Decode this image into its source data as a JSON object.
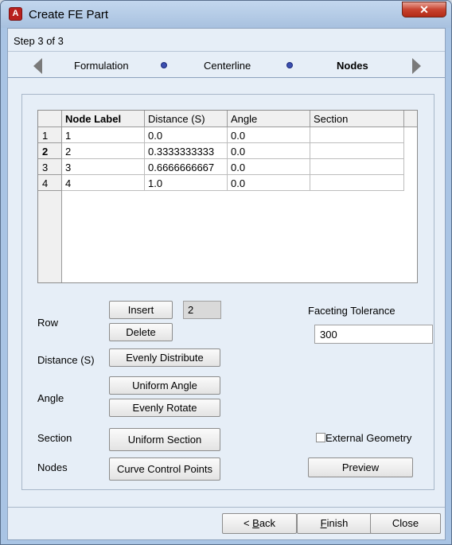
{
  "window": {
    "app_icon_letter": "A",
    "title": "Create FE Part",
    "close_glyph": "✕"
  },
  "step": {
    "label": "Step 3 of 3",
    "steps": [
      "Formulation",
      "Centerline",
      "Nodes"
    ],
    "current": "Nodes"
  },
  "table": {
    "columns": [
      "Node Label",
      "Distance (S)",
      "Angle",
      "Section"
    ],
    "row_headers": [
      "1",
      "2",
      "3",
      "4"
    ],
    "rows": [
      [
        "1",
        "0.0",
        "0.0",
        ""
      ],
      [
        "2",
        "0.3333333333",
        "0.0",
        ""
      ],
      [
        "3",
        "0.6666666667",
        "0.0",
        ""
      ],
      [
        "4",
        "1.0",
        "0.0",
        ""
      ]
    ]
  },
  "controls": {
    "row_label": "Row",
    "insert_label": "Insert",
    "insert_count": "2",
    "delete_label": "Delete",
    "distance_label": "Distance (S)",
    "evenly_distribute_label": "Evenly Distribute",
    "angle_label": "Angle",
    "uniform_angle_label": "Uniform Angle",
    "evenly_rotate_label": "Evenly Rotate",
    "section_label": "Section",
    "uniform_section_label": "Uniform Section",
    "nodes_label": "Nodes",
    "curve_control_points_label": "Curve Control Points",
    "faceting_tolerance_label": "Faceting Tolerance",
    "faceting_tolerance_value": "300",
    "external_geometry_label": "External Geometry",
    "external_geometry_checked": false,
    "preview_label": "Preview"
  },
  "footer": {
    "back_prefix": "< ",
    "back_mnemonic": "B",
    "back_rest": "ack",
    "finish_mnemonic": "F",
    "finish_rest": "inish",
    "close_label": "Close"
  }
}
